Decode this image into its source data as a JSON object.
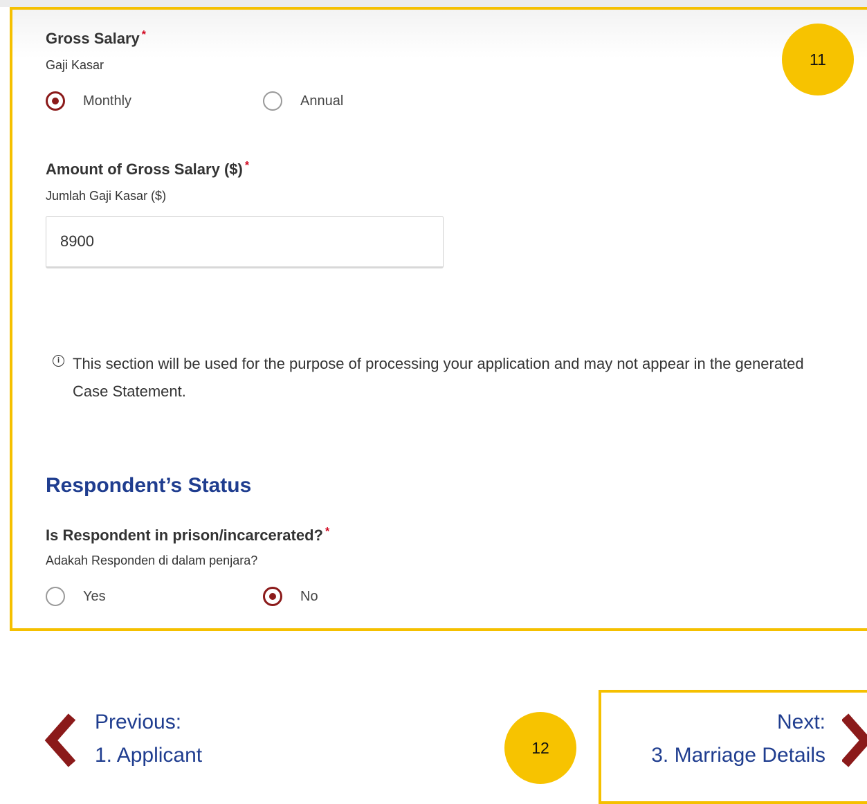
{
  "gross_salary": {
    "label": "Gross Salary",
    "required_mark": "*",
    "sublabel": "Gaji Kasar",
    "options": [
      {
        "label": "Monthly",
        "selected": true
      },
      {
        "label": "Annual",
        "selected": false
      }
    ]
  },
  "amount": {
    "label": "Amount of Gross Salary ($)",
    "required_mark": "*",
    "sublabel": "Jumlah Gaji Kasar ($)",
    "value": "8900"
  },
  "info_note": {
    "icon": "info-icon",
    "text": "This section will be used for the purpose of processing your application and may not appear in the generated Case Statement."
  },
  "respondent_status": {
    "heading": "Respondent’s Status",
    "question": "Is Respondent in prison/incarcerated?",
    "required_mark": "*",
    "sublabel": "Adakah Responden di dalam penjara?",
    "options": [
      {
        "label": "Yes",
        "selected": false
      },
      {
        "label": "No",
        "selected": true
      }
    ]
  },
  "navigation": {
    "previous_label": "Previous:",
    "previous_target": "1. Applicant",
    "next_label": "Next:",
    "next_target": "3. Marriage Details"
  },
  "annotations": {
    "badge_1": "11",
    "badge_2": "12"
  },
  "colors": {
    "highlight_border": "#f5c000",
    "badge_fill": "#f7c300",
    "heading_blue": "#1f3d8f",
    "radio_selected": "#8b1a1a",
    "required_red": "#d0021b"
  }
}
